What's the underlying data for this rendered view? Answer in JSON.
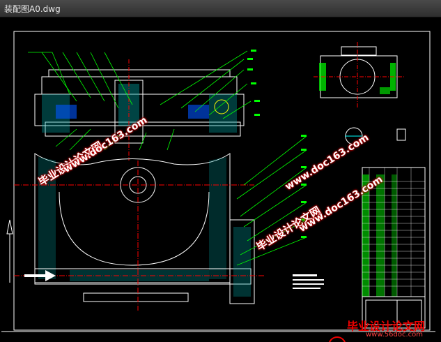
{
  "window": {
    "title": "装配图A0.dwg"
  },
  "watermarks": {
    "text_cn": "毕业设计论文网",
    "url": "www.doc163.com"
  },
  "footer_logo": {
    "text_cn": "毕业设计论文网",
    "url": "www.56doc.com"
  },
  "colors": {
    "canvas": "#000000",
    "frame": "#ffffff",
    "line_green": "#00ff00",
    "hatch_cyan": "#00ffff",
    "center_red": "#ff0000"
  }
}
